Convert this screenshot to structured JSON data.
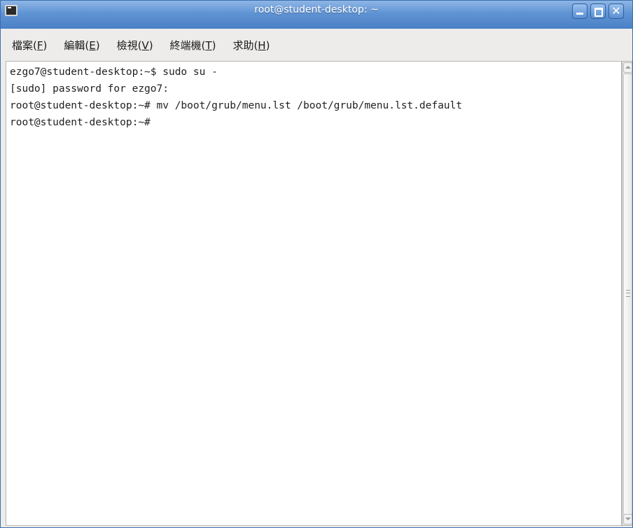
{
  "window": {
    "title": "root@student-desktop: ~",
    "minimize_label": "",
    "maximize_label": "",
    "close_label": "✕"
  },
  "menubar": {
    "items": [
      {
        "prefix": "檔案(",
        "mnemonic": "F",
        "suffix": ")"
      },
      {
        "prefix": "編輯(",
        "mnemonic": "E",
        "suffix": ")"
      },
      {
        "prefix": "檢視(",
        "mnemonic": "V",
        "suffix": ")"
      },
      {
        "prefix": "終端機(",
        "mnemonic": "T",
        "suffix": ")"
      },
      {
        "prefix": "求助(",
        "mnemonic": "H",
        "suffix": ")"
      }
    ]
  },
  "terminal": {
    "lines": [
      "ezgo7@student-desktop:~$ sudo su -",
      "[sudo] password for ezgo7:",
      "root@student-desktop:~# mv /boot/grub/menu.lst /boot/grub/menu.lst.default",
      "root@student-desktop:~#"
    ]
  },
  "colors": {
    "titlebar": "#5f93d3",
    "window_bg": "#edeceb",
    "terminal_bg": "#ffffff",
    "terminal_fg": "#1f1f1f"
  },
  "icons": {
    "app": "terminal-icon",
    "minimize": "minimize-icon",
    "maximize": "maximize-icon",
    "close": "close-icon"
  }
}
